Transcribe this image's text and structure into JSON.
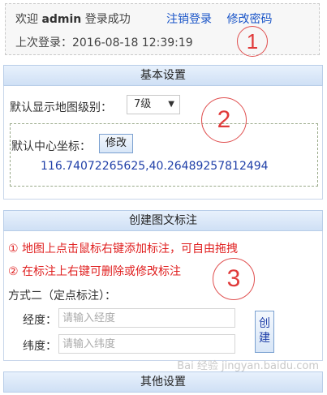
{
  "login": {
    "welcome_prefix": "欢迎",
    "username": "admin",
    "welcome_suffix": "登录成功",
    "logout": "注销登录",
    "change_password": "修改密码",
    "last_login": "上次登录：2016-08-18 12:39:19"
  },
  "annotations": {
    "one": "1",
    "two": "2",
    "three": "3"
  },
  "basic": {
    "title": "基本设置",
    "zoom_label": "默认显示地图级别：",
    "zoom_value": "7级",
    "center_label": "默认中心坐标：",
    "edit_button": "修改",
    "coords": "116.74072265625,40.26489257812494"
  },
  "marker": {
    "title": "创建图文标注",
    "hint1": "① 地图上点击鼠标右键添加标注，可自由拖拽",
    "hint2": "② 在标注上右键可删除或修改标注",
    "method2": "方式二（定点标注）：",
    "lng_label": "经度：",
    "lng_placeholder": "请输入经度",
    "lat_label": "纬度：",
    "lat_placeholder": "请输入纬度",
    "create_line1": "创",
    "create_line2": "建"
  },
  "other": {
    "title": "其他设置"
  },
  "watermark": "Bai 经验 jingyan.baidu.com"
}
